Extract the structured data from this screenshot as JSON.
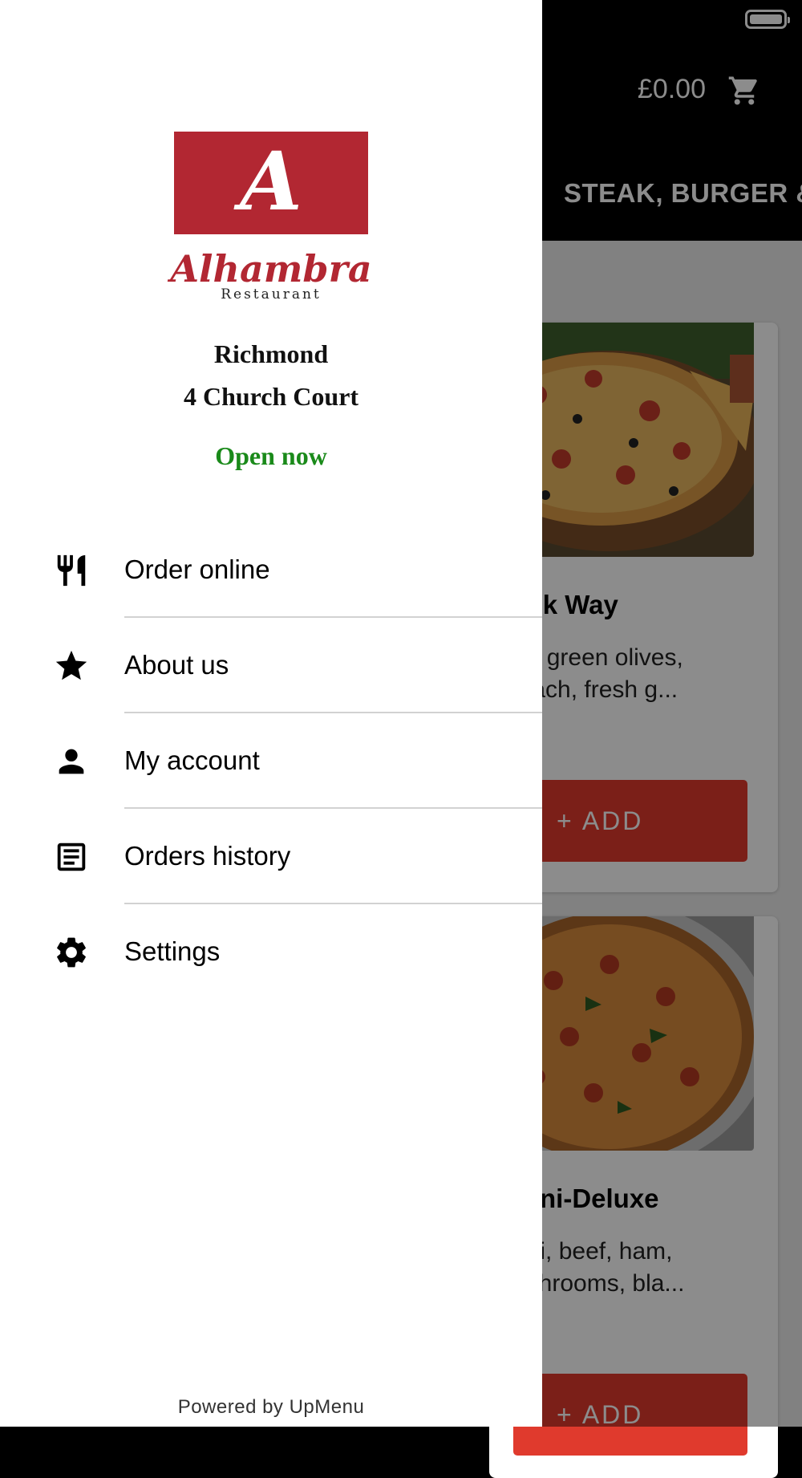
{
  "status_bar": {
    "battery_icon": "battery-full-icon"
  },
  "header": {
    "cart_total": "£0.00",
    "cart_icon": "shopping-cart-icon",
    "category_tab": "STEAK, BURGER &"
  },
  "products": [
    {
      "title": "eek Way",
      "desc_line1": "nd green olives,",
      "desc_line2": "inach, fresh  g...",
      "add_label": "+ ADD"
    },
    {
      "title": "roni-Deluxe",
      "desc_line1": "oni, beef, ham,",
      "desc_line2": "ushrooms, bla...",
      "add_label": "+ ADD"
    }
  ],
  "drawer": {
    "logo_letter": "A",
    "logo_name": "Alhambra",
    "logo_subtitle": "Restaurant",
    "location_name": "Richmond",
    "location_address": "4 Church Court",
    "open_status": "Open now",
    "items": [
      {
        "label": "Order online",
        "icon": "fork-knife-icon"
      },
      {
        "label": "About us",
        "icon": "star-icon"
      },
      {
        "label": "My account",
        "icon": "person-icon"
      },
      {
        "label": "Orders history",
        "icon": "receipt-icon"
      },
      {
        "label": "Settings",
        "icon": "gear-icon"
      }
    ],
    "footer": "Powered by UpMenu"
  },
  "colors": {
    "brand_red": "#b22732",
    "add_button": "#e03a2d",
    "open_green": "#1a8a1a"
  }
}
